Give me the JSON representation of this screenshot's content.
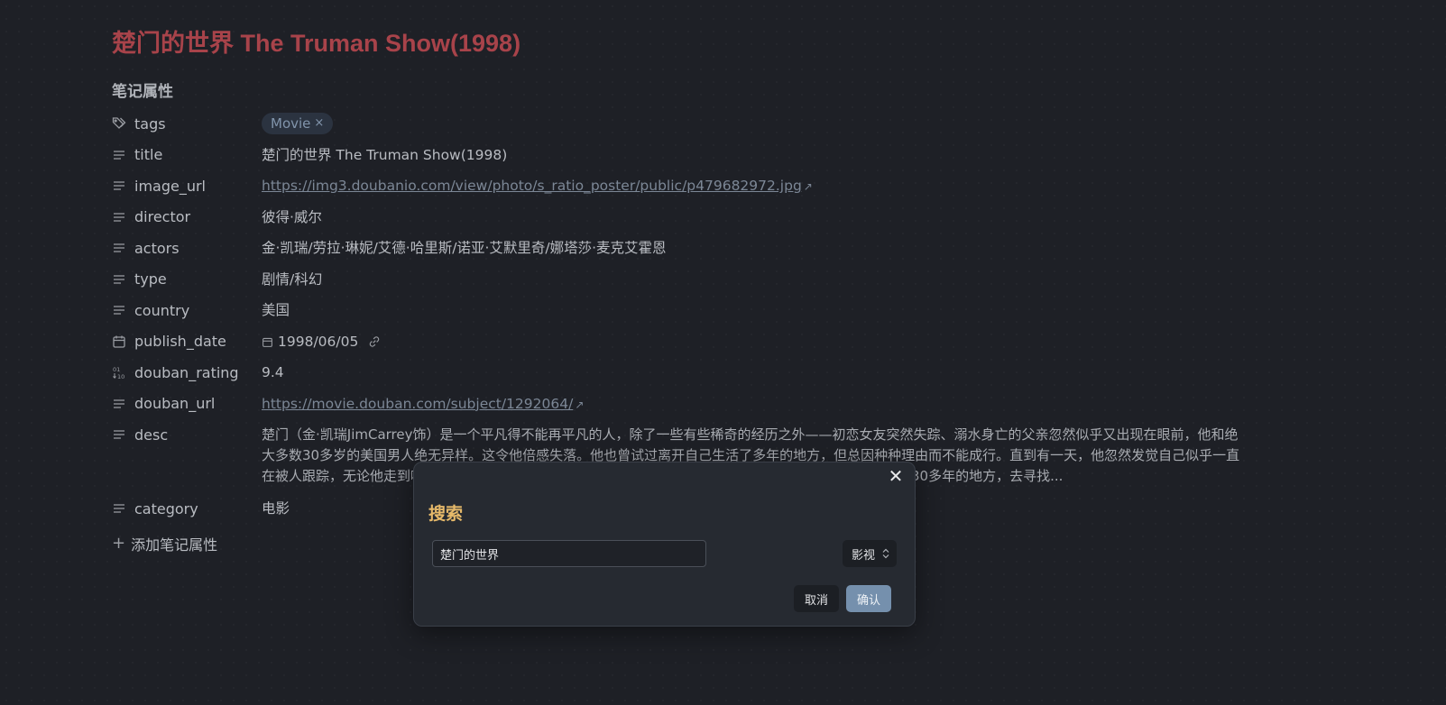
{
  "note": {
    "title": "楚门的世界 The Truman Show(1998)",
    "properties_heading": "笔记属性",
    "add_property_label": "添加笔记属性"
  },
  "properties": {
    "tags": {
      "key": "tags",
      "icon": "tag-icon",
      "value": "Movie",
      "remove": "×"
    },
    "title": {
      "key": "title",
      "icon": "text-icon",
      "value": "楚门的世界 The Truman Show(1998)"
    },
    "image_url": {
      "key": "image_url",
      "icon": "text-icon",
      "value": "https://img3.doubanio.com/view/photo/s_ratio_poster/public/p479682972.jpg"
    },
    "director": {
      "key": "director",
      "icon": "text-icon",
      "value": "彼得·威尔"
    },
    "actors": {
      "key": "actors",
      "icon": "text-icon",
      "value": "金·凯瑞/劳拉·琳妮/艾德·哈里斯/诺亚·艾默里奇/娜塔莎·麦克艾霍恩"
    },
    "type": {
      "key": "type",
      "icon": "text-icon",
      "value": "剧情/科幻"
    },
    "country": {
      "key": "country",
      "icon": "text-icon",
      "value": "美国"
    },
    "publish_date": {
      "key": "publish_date",
      "icon": "calendar-icon",
      "value": "1998/06/05"
    },
    "douban_rating": {
      "key": "douban_rating",
      "icon": "number-icon",
      "value": "9.4"
    },
    "douban_url": {
      "key": "douban_url",
      "icon": "text-icon",
      "value": "https://movie.douban.com/subject/1292064/"
    },
    "desc": {
      "key": "desc",
      "icon": "text-icon",
      "value": "楚门（金·凯瑞JimCarrey饰）是一个平凡得不能再平凡的人，除了一些有些稀奇的经历之外——初恋女友突然失踪、溺水身亡的父亲忽然似乎又出现在眼前，他和绝大多数30多岁的美国男人绝无异样。这令他倍感失落。他也曾试过离开自己生活了多年的地方，但总因种种理由而不能成行。直到有一天，他忽然发觉自己似乎一直在被人跟踪，无论他走到哪里，干什么事情。这种感觉愈来愈强烈。楚门决定不惜一切代价逃离这个他生活了30多年的地方，去寻找..."
    },
    "category": {
      "key": "category",
      "icon": "text-icon",
      "value": "电影"
    }
  },
  "dialog": {
    "title": "搜索",
    "close": "✕",
    "search_value": "楚门的世界",
    "type_selected": "影视",
    "cancel_label": "取消",
    "confirm_label": "确认"
  },
  "colors": {
    "background": "#1e2026",
    "title": "#a8434a",
    "dialog_title": "#e6b96a",
    "confirm": "#7590ad"
  }
}
